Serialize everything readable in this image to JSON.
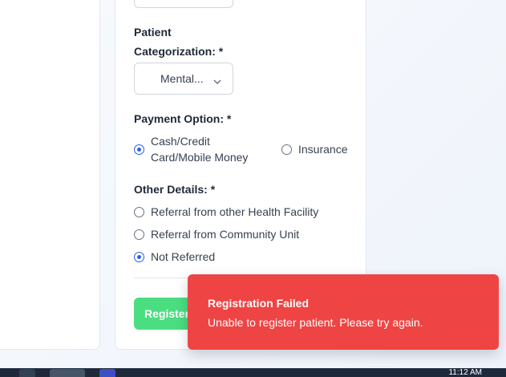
{
  "form": {
    "patient_categorization_line1": "Patient",
    "patient_categorization_line2": "Categorization: *",
    "category_selected": "Mental...",
    "payment_label": "Payment Option: *",
    "payment_options": [
      {
        "line1": "Cash/Credit",
        "line2": "Card/Mobile Money",
        "checked": true
      },
      {
        "label": "Insurance",
        "checked": false
      }
    ],
    "other_details_label": "Other Details: *",
    "other_details_options": [
      {
        "label": "Referral from other Health Facility",
        "checked": false
      },
      {
        "label": "Referral from Community Unit",
        "checked": false
      },
      {
        "label": "Not Referred",
        "checked": true
      }
    ],
    "register_label": "Register"
  },
  "toast": {
    "title": "Registration Failed",
    "message": "Unable to register patient. Please try again.",
    "color": "#ef4444"
  },
  "taskbar": {
    "clock": "11:12 AM"
  },
  "colors": {
    "accent": "#2563eb",
    "register_button": "#4ade80"
  }
}
